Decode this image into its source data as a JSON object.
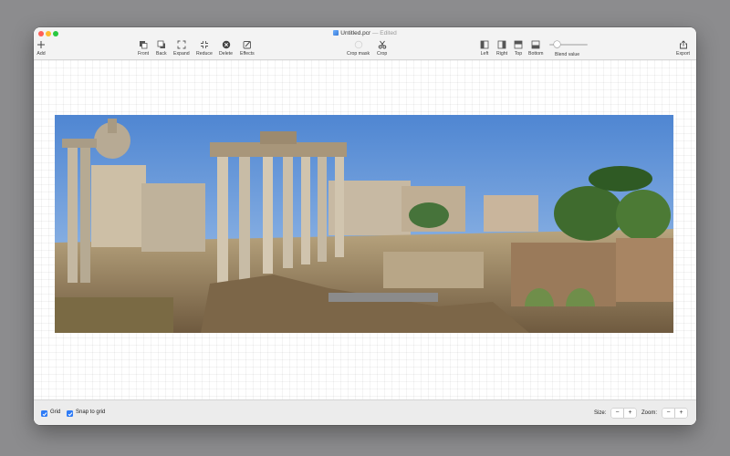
{
  "window": {
    "title": "Untitled.pcr",
    "separator": " — ",
    "status": "Edited"
  },
  "toolbar": {
    "add": "Add",
    "front": "Front",
    "back": "Back",
    "expand": "Expand",
    "reduce": "Reduce",
    "delete": "Delete",
    "effects": "Effects",
    "crop_mask": "Crop mask",
    "crop": "Crop",
    "left": "Left",
    "right": "Right",
    "top": "Top",
    "bottom": "Bottom",
    "blend_value": "Blend value",
    "export": "Export"
  },
  "blend": {
    "value_fraction": 0.15
  },
  "footer": {
    "grid": "Grid",
    "snap_to_grid": "Snap to grid",
    "size": "Size:",
    "zoom": "Zoom:",
    "minus": "−",
    "plus": "+"
  },
  "checkboxes": {
    "grid_checked": true,
    "snap_checked": true
  },
  "colors": {
    "accent": "#2f7cf6",
    "sky": "#5a8fd6",
    "stone": "#c9b99a"
  }
}
